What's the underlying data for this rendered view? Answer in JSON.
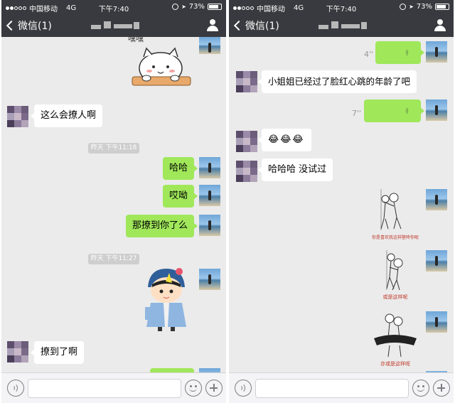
{
  "status_bar": {
    "carrier": "中国移动",
    "network": "4G",
    "time": "下午7:40",
    "battery": "73%",
    "battery_fraction": 0.73,
    "icons": [
      "signal-dots-icon",
      "rotation-lock-icon",
      "location-arrow-icon",
      "battery-icon"
    ]
  },
  "nav": {
    "back_label": "微信(1)",
    "title_obscured": true,
    "right_icon": "profile-icon"
  },
  "colors": {
    "nav_bg": "#393a3f",
    "chat_bg": "#ebebeb",
    "bubble_out": "#a0e75a",
    "bubble_in": "#ffffff",
    "time_sep_bg": "#cecece"
  },
  "left": {
    "sticker_text": "嘿嘿",
    "messages": {
      "m1": "这么会撩人啊",
      "m2": "哈哈",
      "m3": "哎呦",
      "m4": "那撩到你了么",
      "m5": "撩到了啊"
    },
    "times": {
      "t1": "昨天 下午11:18",
      "t2": "昨天 下午11:27"
    }
  },
  "right": {
    "voice": {
      "v1": "4''",
      "v2": "7''"
    },
    "messages": {
      "m1": "小姐姐已经过了脸红心跳的年龄了吧",
      "m2": "😂😂😂",
      "m3": "哈哈哈 没试过"
    },
    "sticker_captions": {
      "c1": "你是喜欢我这样壁咚你呢",
      "c2": "或是这样呢",
      "c3": "亦或是这样呢"
    }
  },
  "input_bar": {
    "voice_icon": "voice-icon",
    "emoji_icon": "emoji-icon",
    "plus_icon": "plus-icon"
  }
}
